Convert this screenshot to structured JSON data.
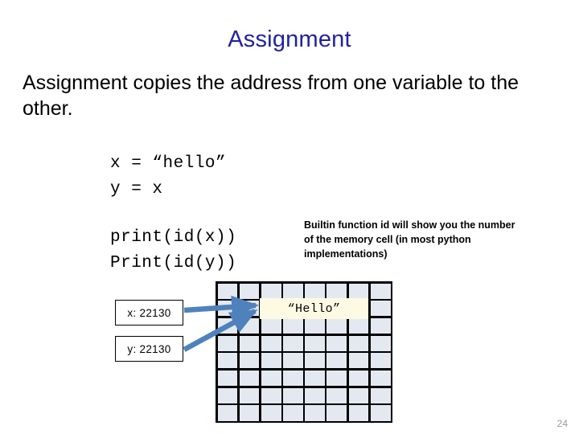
{
  "slide": {
    "title": "Assignment",
    "page_number": "24",
    "title_color": "#2121a5",
    "accent_arrow_color": "#4f81bd",
    "grid_cell_color": "#e4e9f1",
    "value_cell_color": "#fdfae4"
  },
  "body": {
    "paragraph": "Assignment copies the address from one variable to the other."
  },
  "code": {
    "assignment": "x = “hello”\ny = x",
    "print_calls": "print(id(x))\nPrint(id(y))"
  },
  "annotation": {
    "note": "Builtin function id will show you the number of the memory cell (in most python implementations)"
  },
  "variables": [
    {
      "name": "var-box-x",
      "label": "x: 22130"
    },
    {
      "name": "var-box-y",
      "label": "y: 22130"
    }
  ],
  "memory": {
    "columns": 8,
    "rows": 8,
    "value_cell_text": "“Hello”",
    "value_cell_row": 2,
    "value_cell_col_start": 3,
    "value_cell_col_span": 5
  }
}
